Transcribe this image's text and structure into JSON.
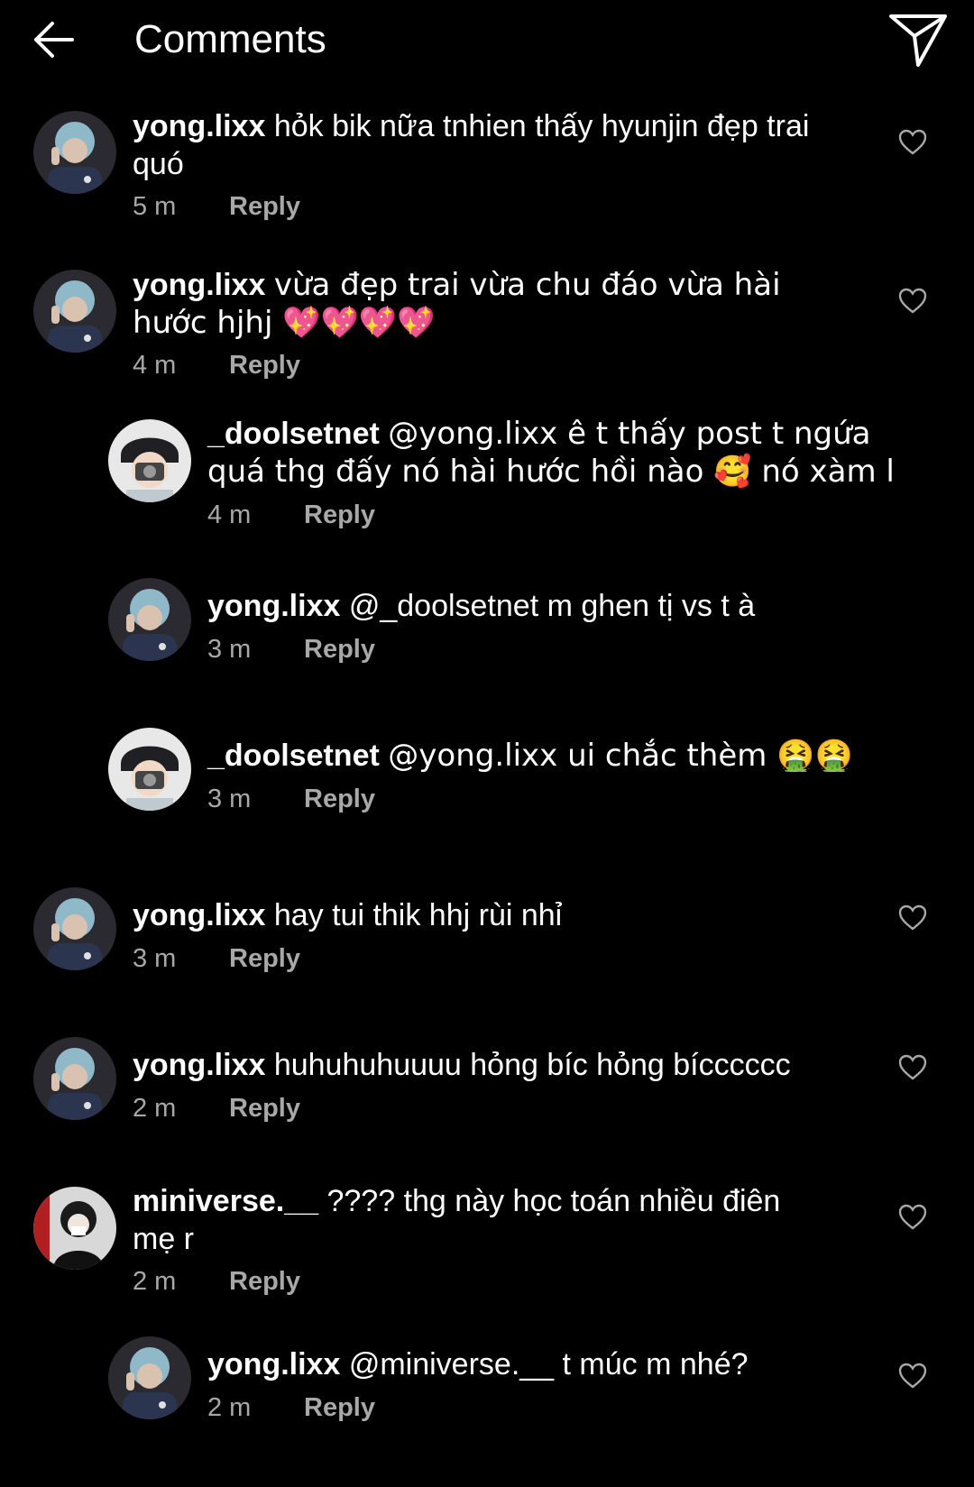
{
  "header": {
    "title": "Comments",
    "back_icon": "arrow-left-icon",
    "send_icon": "paper-plane-icon"
  },
  "comments": [
    {
      "username": "yong.lixx",
      "text": "hỏk bik nữa tnhien thấy hyunjin đẹp trai quó",
      "time": "5 m",
      "reply": "Reply",
      "avatar": "yong"
    },
    {
      "username": "yong.lixx",
      "text": "vừa đẹp trai vừa chu đáo vừa hài hước hjhj 💖💖💖💖",
      "time": "4 m",
      "reply": "Reply",
      "avatar": "yong"
    },
    {
      "username": "_doolsetnet",
      "text": "@yong.lixx ê t thấy post t ngứa quá thg đấy nó hài hước hồi nào 🥰 nó xàm l",
      "time": "4 m",
      "reply": "Reply",
      "avatar": "dool"
    },
    {
      "username": "yong.lixx",
      "text": "@_doolsetnet m ghen tị vs t à",
      "time": "3 m",
      "reply": "Reply",
      "avatar": "yong"
    },
    {
      "username": "_doolsetnet",
      "text": "@yong.lixx ui chắc thèm 🤮🤮",
      "time": "3 m",
      "reply": "Reply",
      "avatar": "dool"
    },
    {
      "username": "yong.lixx",
      "text": "hay tui thik hhj rùi nhỉ",
      "time": "3 m",
      "reply": "Reply",
      "avatar": "yong"
    },
    {
      "username": "yong.lixx",
      "text": "huhuhuhuuuu hỏng bíc hỏng bícccccc",
      "time": "2 m",
      "reply": "Reply",
      "avatar": "yong"
    },
    {
      "username": "miniverse.__",
      "text": "???? thg này học toán nhiều điên mẹ r",
      "time": "2 m",
      "reply": "Reply",
      "avatar": "mini"
    },
    {
      "username": "yong.lixx",
      "text": "@miniverse.__ t múc m nhé?",
      "time": "2 m",
      "reply": "Reply",
      "avatar": "yong"
    }
  ]
}
